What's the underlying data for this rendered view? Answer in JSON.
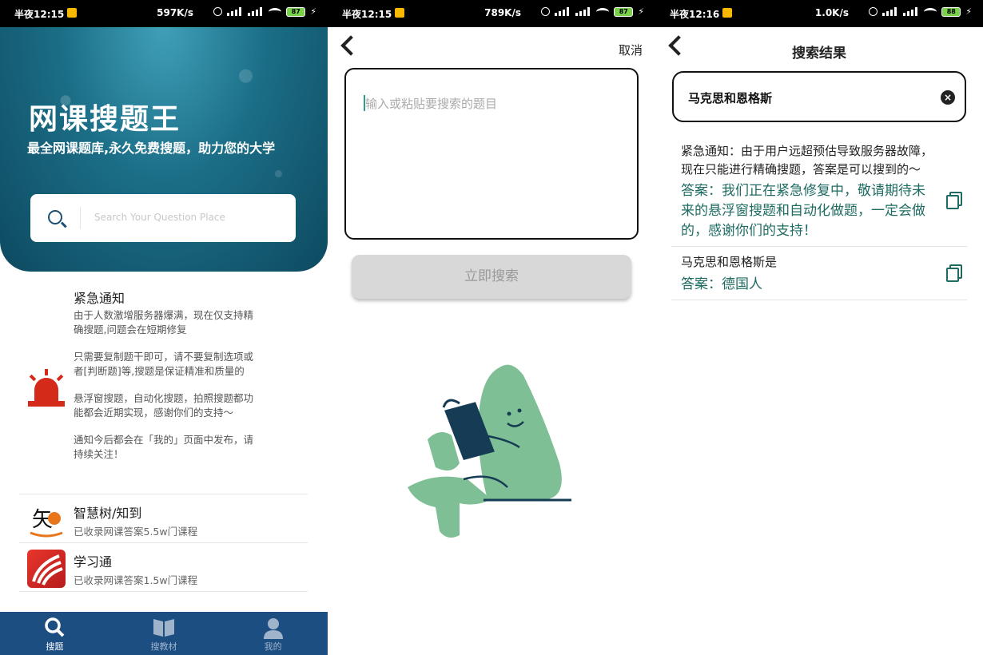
{
  "panels": [
    {
      "statusbar": {
        "time": "半夜12:15",
        "speed": "597K/s",
        "battery": "87"
      },
      "hero": {
        "title": "网课搜题王",
        "subtitle": "最全网课题库,永久免费搜题，助力您的大学",
        "search_placeholder": "Search Your Question Place"
      },
      "notice": {
        "title": "紧急通知",
        "paragraphs": [
          "由于人数激增服务器爆满，现在仅支持精确搜题,问题会在短期修复",
          "只需要复制题干即可，请不要复制选项或者[判断题]等,搜题是保证精准和质量的",
          "悬浮窗搜题，自动化搜题，拍照搜题都功能都会近期实现，感谢你们的支持～",
          "通知今后都会在「我的」页面中发布，请持续关注！"
        ]
      },
      "sources": [
        {
          "name": "智慧树/知到",
          "desc": "已收录网课答案5.5w门课程",
          "logo": "zhihuishu-logo"
        },
        {
          "name": "学习通",
          "desc": "已收录网课答案1.5w门课程",
          "logo": "xuexitong-logo"
        }
      ],
      "nav": [
        {
          "label": "搜题",
          "icon": "search-icon",
          "active": true
        },
        {
          "label": "搜教材",
          "icon": "book-icon",
          "active": false
        },
        {
          "label": "我的",
          "icon": "person-icon",
          "active": false
        }
      ]
    },
    {
      "statusbar": {
        "time": "半夜12:15",
        "speed": "789K/s",
        "battery": "87"
      },
      "cancel_label": "取消",
      "question_placeholder": "输入或粘贴要搜索的题目",
      "search_button": "立即搜索"
    },
    {
      "statusbar": {
        "time": "半夜12:16",
        "speed": "1.0K/s",
        "battery": "88"
      },
      "title": "搜索结果",
      "query": "马克思和恩格斯",
      "results": [
        {
          "question": "紧急通知：由于用户远超预估导致服务器故障，现在只能进行精确搜题，答案是可以搜到的～",
          "answer": "答案：我们正在紧急修复中，敬请期待未来的悬浮窗搜题和自动化做题，一定会做的，感谢你们的支持！"
        },
        {
          "question": "马克思和恩格斯是",
          "answer": "答案：德国人"
        }
      ]
    }
  ],
  "colors": {
    "nav_bg": "#1c4e82",
    "answer_text": "#1e6b62",
    "illustration_green": "#7fbf95",
    "illustration_navy": "#163c55"
  }
}
